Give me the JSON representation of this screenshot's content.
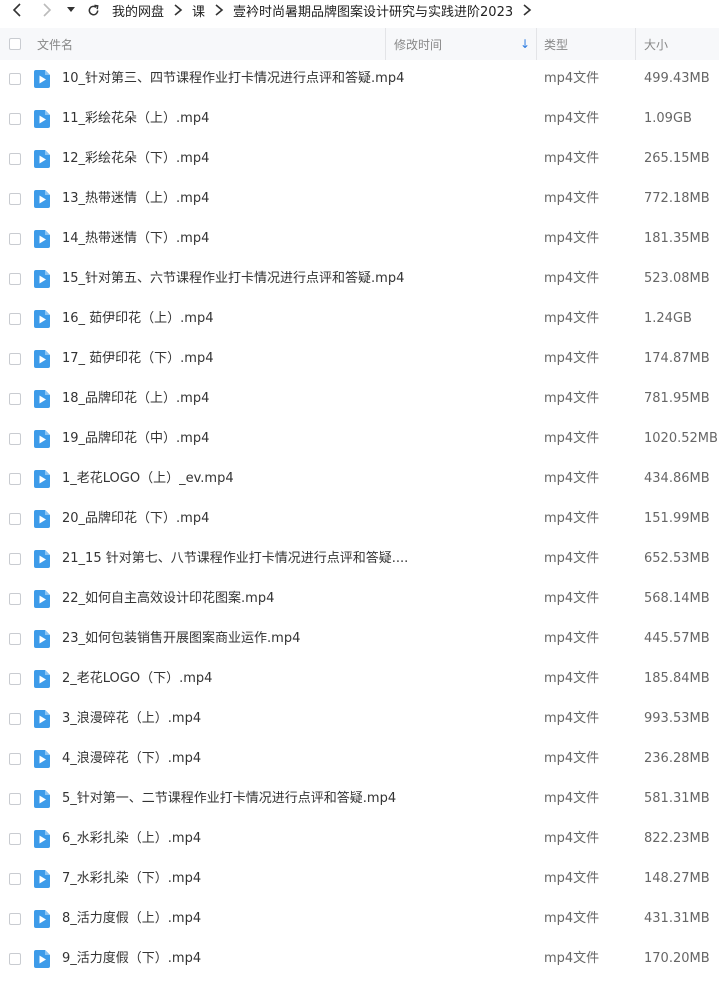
{
  "nav": {
    "icons": [
      "back-icon",
      "forward-icon",
      "dropdown-icon",
      "refresh-icon"
    ],
    "breadcrumbs": [
      "我的网盘",
      "课",
      "壹衿时尚暑期品牌图案设计研究与实践进阶2023"
    ]
  },
  "table": {
    "columns": {
      "name": "文件名",
      "modified": "修改时间",
      "type": "类型",
      "size": "大小"
    },
    "sort_indicator": "↓",
    "rows": [
      {
        "name": "10_针对第三、四节课程作业打卡情况进行点评和答疑.mp4",
        "type": "mp4文件",
        "size": "499.43MB"
      },
      {
        "name": "11_彩绘花朵（上）.mp4",
        "type": "mp4文件",
        "size": "1.09GB"
      },
      {
        "name": "12_彩绘花朵（下）.mp4",
        "type": "mp4文件",
        "size": "265.15MB"
      },
      {
        "name": "13_热带迷情（上）.mp4",
        "type": "mp4文件",
        "size": "772.18MB"
      },
      {
        "name": "14_热带迷情（下）.mp4",
        "type": "mp4文件",
        "size": "181.35MB"
      },
      {
        "name": "15_针对第五、六节课程作业打卡情况进行点评和答疑.mp4",
        "type": "mp4文件",
        "size": "523.08MB"
      },
      {
        "name": "16_ 茹伊印花（上）.mp4",
        "type": "mp4文件",
        "size": "1.24GB"
      },
      {
        "name": "17_ 茹伊印花（下）.mp4",
        "type": "mp4文件",
        "size": "174.87MB"
      },
      {
        "name": "18_品牌印花（上）.mp4",
        "type": "mp4文件",
        "size": "781.95MB"
      },
      {
        "name": "19_品牌印花（中）.mp4",
        "type": "mp4文件",
        "size": "1020.52MB"
      },
      {
        "name": "1_老花LOGO（上）_ev.mp4",
        "type": "mp4文件",
        "size": "434.86MB"
      },
      {
        "name": "20_品牌印花（下）.mp4",
        "type": "mp4文件",
        "size": "151.99MB"
      },
      {
        "name": "21_15 针对第七、八节课程作业打卡情况进行点评和答疑....",
        "type": "mp4文件",
        "size": "652.53MB"
      },
      {
        "name": "22_如何自主高效设计印花图案.mp4",
        "type": "mp4文件",
        "size": "568.14MB"
      },
      {
        "name": "23_如何包装销售开展图案商业运作.mp4",
        "type": "mp4文件",
        "size": "445.57MB"
      },
      {
        "name": "2_老花LOGO（下）.mp4",
        "type": "mp4文件",
        "size": "185.84MB"
      },
      {
        "name": "3_浪漫碎花（上）.mp4",
        "type": "mp4文件",
        "size": "993.53MB"
      },
      {
        "name": "4_浪漫碎花（下）.mp4",
        "type": "mp4文件",
        "size": "236.28MB"
      },
      {
        "name": "5_针对第一、二节课程作业打卡情况进行点评和答疑.mp4",
        "type": "mp4文件",
        "size": "581.31MB"
      },
      {
        "name": "6_水彩扎染（上）.mp4",
        "type": "mp4文件",
        "size": "822.23MB"
      },
      {
        "name": "7_水彩扎染（下）.mp4",
        "type": "mp4文件",
        "size": "148.27MB"
      },
      {
        "name": "8_活力度假（上）.mp4",
        "type": "mp4文件",
        "size": "431.31MB"
      },
      {
        "name": "9_活力度假（下）.mp4",
        "type": "mp4文件",
        "size": "170.20MB"
      }
    ]
  },
  "colors": {
    "file_icon": "#3d9be9",
    "header_bg": "#f7f8fa",
    "sort_arrow": "#2f7de1"
  }
}
